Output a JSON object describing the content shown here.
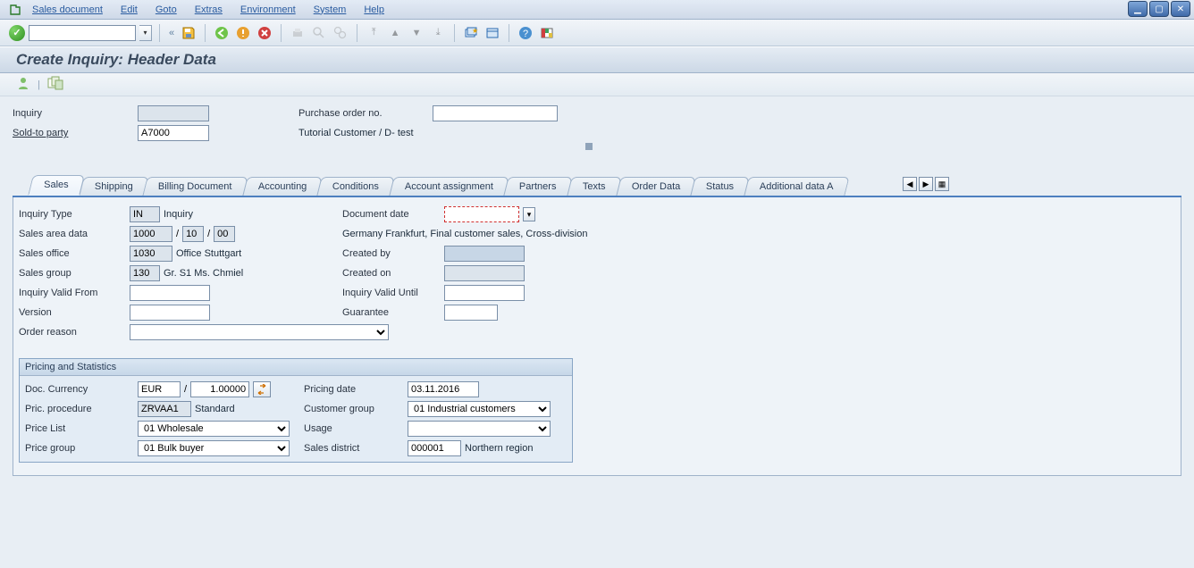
{
  "menu": {
    "items": [
      "Sales document",
      "Edit",
      "Goto",
      "Extras",
      "Environment",
      "System",
      "Help"
    ]
  },
  "title": "Create Inquiry: Header Data",
  "header": {
    "inquiry_label": "Inquiry",
    "inquiry_val": "",
    "po_label": "Purchase order no.",
    "po_val": "",
    "soldto_label": "Sold-to party",
    "soldto_val": "A7000",
    "soldto_desc": "Tutorial Customer / D- test"
  },
  "tabs": [
    "Sales",
    "Shipping",
    "Billing Document",
    "Accounting",
    "Conditions",
    "Account assignment",
    "Partners",
    "Texts",
    "Order Data",
    "Status",
    "Additional data A"
  ],
  "sales": {
    "inquiry_type_label": "Inquiry Type",
    "inquiry_type_val": "IN",
    "inquiry_type_desc": "Inquiry",
    "doc_date_label": "Document date",
    "doc_date_val": "",
    "sales_area_label": "Sales area data",
    "sales_area_org": "1000",
    "sales_area_ch": "10",
    "sales_area_div": "00",
    "sales_area_desc": "Germany Frankfurt, Final customer sales, Cross-division",
    "sales_office_label": "Sales office",
    "sales_office_val": "1030",
    "sales_office_desc": "Office Stuttgart",
    "created_by_label": "Created by",
    "created_by_val": "",
    "sales_group_label": "Sales group",
    "sales_group_val": "130",
    "sales_group_desc": "Gr. S1 Ms. Chmiel",
    "created_on_label": "Created on",
    "created_on_val": "",
    "valid_from_label": "Inquiry Valid From",
    "valid_from_val": "",
    "valid_until_label": "Inquiry Valid Until",
    "valid_until_val": "",
    "version_label": "Version",
    "version_val": "",
    "guarantee_label": "Guarantee",
    "guarantee_val": "",
    "order_reason_label": "Order reason",
    "order_reason_val": ""
  },
  "pricing": {
    "title": "Pricing and Statistics",
    "doc_curr_label": "Doc. Currency",
    "doc_curr_val": "EUR",
    "exch_rate_val": "1.00000",
    "pricing_date_label": "Pricing date",
    "pricing_date_val": "03.11.2016",
    "proc_label": "Pric. procedure",
    "proc_val": "ZRVAA1",
    "proc_desc": "Standard",
    "cust_group_label": "Customer group",
    "cust_group_val": "01 Industrial customers",
    "price_list_label": "Price List",
    "price_list_val": "01 Wholesale",
    "usage_label": "Usage",
    "usage_val": "",
    "price_group_label": "Price group",
    "price_group_val": "01 Bulk buyer",
    "sales_district_label": "Sales district",
    "sales_district_val": "000001",
    "sales_district_desc": "Northern region"
  }
}
